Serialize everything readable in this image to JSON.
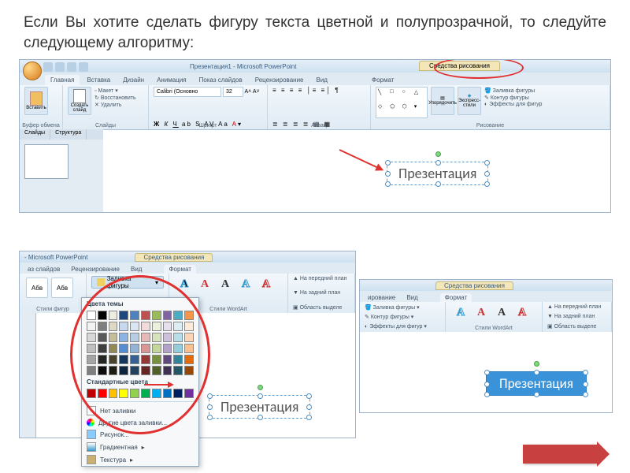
{
  "slide": {
    "title": "Если Вы хотите сделать фигуру текста цветной и полупрозрачной, то следуйте следующему алгоритму:"
  },
  "app": {
    "title": "Презентация1 - Microsoft PowerPoint",
    "title_short": "- Microsoft PowerPoint",
    "drawing_tools": "Средства рисования",
    "sample_text": "Презентация"
  },
  "tabs": {
    "home": "Главная",
    "insert": "Вставка",
    "design": "Дизайн",
    "anim": "Анимация",
    "show": "Показ слайдов",
    "review": "Рецензирование",
    "view": "Вид",
    "format": "Формат",
    "show_short": "аз слайдов"
  },
  "groups": {
    "clipboard": "Буфер обмена",
    "slides": "Слайды",
    "font": "Шрифт",
    "paragraph": "Абзац",
    "drawing": "Рисование",
    "shape_styles": "Стили фигур",
    "wordart_styles": "Стили WordArt"
  },
  "btn": {
    "paste": "Вставить",
    "new_slide": "Создать слайд",
    "layout": "Макет",
    "reset": "Восстановить",
    "delete": "Удалить",
    "arrange": "Упорядочить",
    "quick_styles": "Экспресс-стили",
    "shape_fill": "Заливка фигуры",
    "shape_outline": "Контур фигуры",
    "shape_effects": "Эффекты для фигур",
    "bring_front": "На передний план",
    "send_back": "На задний план",
    "selection": "Область выделе"
  },
  "font": {
    "name": "Calibri (Основно",
    "size": "32"
  },
  "side": {
    "slides": "Слайды",
    "outline": "Структура"
  },
  "colors": {
    "theme_label": "Цвета темы",
    "standard_label": "Стандартные цвета",
    "no_fill": "Нет заливки",
    "more_fill": "Другие цвета заливки...",
    "picture": "Рисунок...",
    "gradient": "Градиентная",
    "texture": "Текстура",
    "theme_row1": [
      "#ffffff",
      "#000000",
      "#eeece1",
      "#1f497d",
      "#4f81bd",
      "#c0504d",
      "#9bbb59",
      "#8064a2",
      "#4bacc6",
      "#f79646"
    ],
    "theme_row2": [
      "#f2f2f2",
      "#7f7f7f",
      "#ddd9c3",
      "#c6d9f0",
      "#dbe5f1",
      "#f2dcdb",
      "#ebf1dd",
      "#e5e0ec",
      "#dbeef3",
      "#fdeada"
    ],
    "theme_row3": [
      "#d8d8d8",
      "#595959",
      "#c4bd97",
      "#8db3e2",
      "#b8cce4",
      "#e5b9b7",
      "#d7e3bc",
      "#ccc1d9",
      "#b7dde8",
      "#fbd5b5"
    ],
    "theme_row4": [
      "#bfbfbf",
      "#3f3f3f",
      "#938953",
      "#548dd4",
      "#95b3d7",
      "#d99694",
      "#c3d69b",
      "#b2a2c7",
      "#92cddc",
      "#fac08f"
    ],
    "theme_row5": [
      "#a5a5a5",
      "#262626",
      "#494429",
      "#17365d",
      "#366092",
      "#953734",
      "#76923c",
      "#5f497a",
      "#31859b",
      "#e36c09"
    ],
    "theme_row6": [
      "#7f7f7f",
      "#0c0c0c",
      "#1d1b10",
      "#0f243e",
      "#244061",
      "#632423",
      "#4f6128",
      "#3f3151",
      "#205867",
      "#974806"
    ],
    "standard": [
      "#c00000",
      "#ff0000",
      "#ffc000",
      "#ffff00",
      "#92d050",
      "#00b050",
      "#00b0f0",
      "#0070c0",
      "#002060",
      "#7030a0"
    ]
  }
}
